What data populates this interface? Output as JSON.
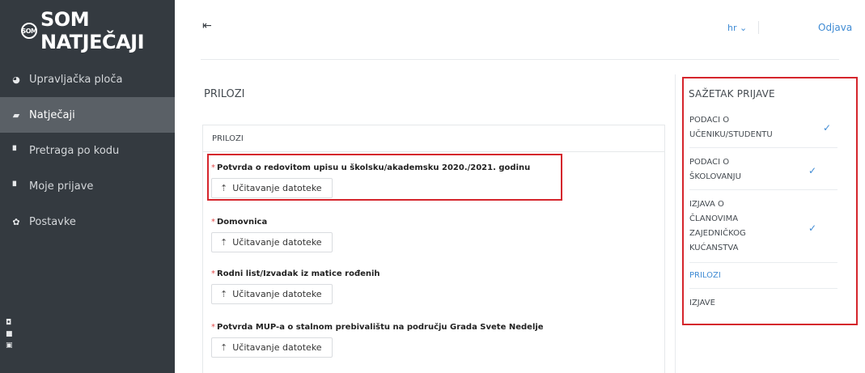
{
  "app": {
    "logo_text": "SOM NATJEČAJI",
    "logo_mark": "SOM"
  },
  "sidebar": {
    "items": [
      {
        "label": "Upravljačka ploča",
        "icon": "pie-chart-icon",
        "glyph": "◕",
        "active": false
      },
      {
        "label": "Natječaji",
        "icon": "folder-open-icon",
        "glyph": "▰",
        "active": true
      },
      {
        "label": "Pretraga po kodu",
        "icon": "file-icon",
        "glyph": "▘",
        "active": false
      },
      {
        "label": "Moje prijave",
        "icon": "file-icon",
        "glyph": "▘",
        "active": false
      },
      {
        "label": "Postavke",
        "icon": "gear-icon",
        "glyph": "✿",
        "active": false
      }
    ]
  },
  "topbar": {
    "language": "hr ⌄",
    "logout": "Odjava"
  },
  "main": {
    "section_title": "PRILOZI",
    "card_title": "PRILOZI",
    "upload_label": "Učitavanje datoteke",
    "required_mark": "*",
    "attachments": [
      {
        "label": "Potvrda o redovitom upisu u školsku/akademsku 2020./2021. godinu"
      },
      {
        "label": "Domovnica"
      },
      {
        "label": "Rodni list/Izvadak iz matice rođenih"
      },
      {
        "label": "Potvrda MUP-a o stalnom prebivalištu na području Grada Svete Nedelje"
      }
    ]
  },
  "summary": {
    "title": "SAŽETAK PRIJAVE",
    "steps": [
      {
        "lines": [
          "PODACI O",
          "UČENIKU/STUDENTU"
        ],
        "completed": true,
        "active": false
      },
      {
        "lines": [
          "PODACI O",
          "ŠKOLOVANJU"
        ],
        "completed": true,
        "active": false
      },
      {
        "lines": [
          "IZJAVA O",
          "ČLANOVIMA",
          "ZAJEDNIČKOG",
          "KUĆANSTVA"
        ],
        "completed": true,
        "active": false
      },
      {
        "lines": [
          "PRILOZI"
        ],
        "completed": false,
        "active": true
      },
      {
        "lines": [
          "IZJAVE"
        ],
        "completed": false,
        "active": false
      }
    ]
  },
  "colors": {
    "sidebar_bg": "#343a40",
    "sidebar_active": "#5a6066",
    "accent": "#3f8bd4",
    "highlight": "#d5252c",
    "required": "#e24b4b"
  }
}
